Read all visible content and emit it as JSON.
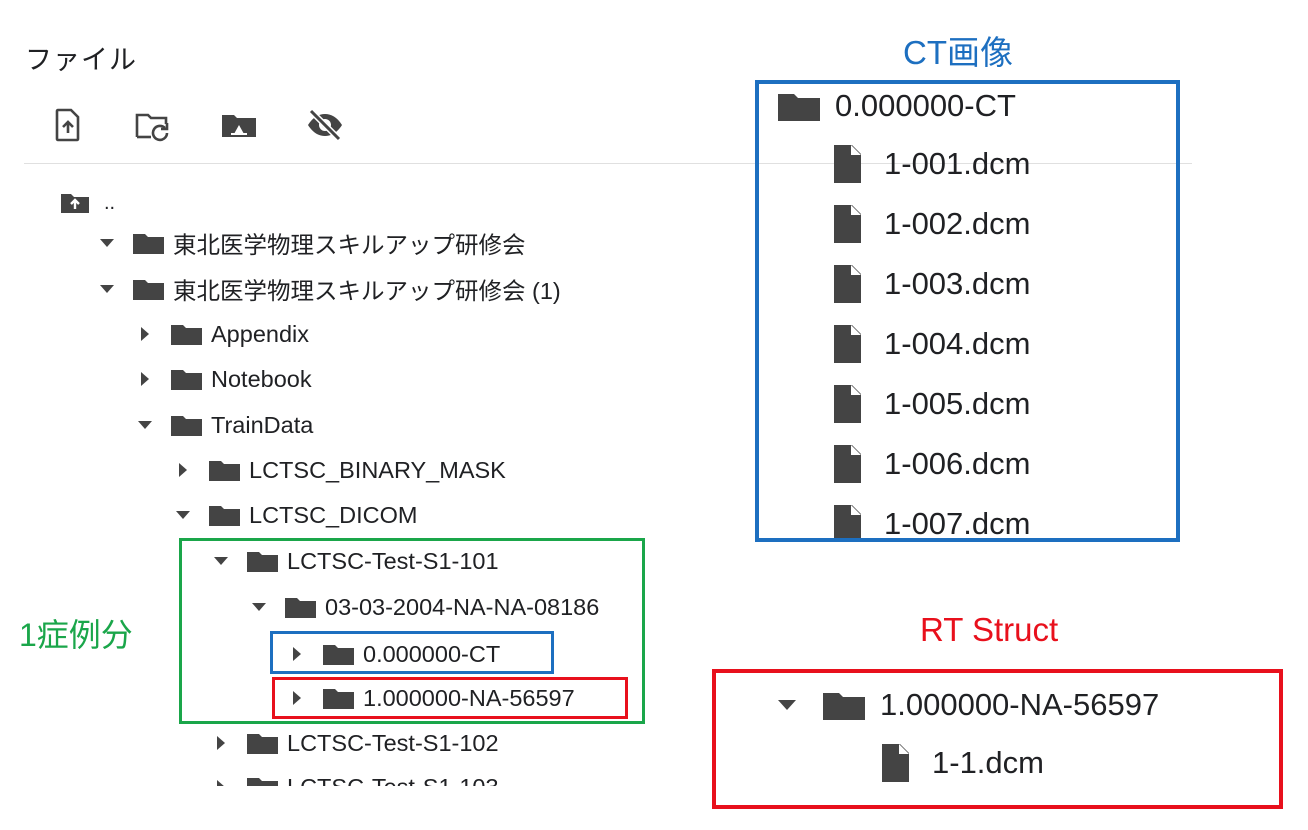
{
  "panel": {
    "title": "ファイル",
    "toolbar": [
      {
        "icon": "upload-file-icon"
      },
      {
        "icon": "refresh-folder-icon"
      },
      {
        "icon": "mount-drive-icon"
      },
      {
        "icon": "hide-hidden-files-icon"
      }
    ],
    "parent_label": ".."
  },
  "tree": [
    {
      "label": "東北医学物理スキルアップ研修会",
      "state": "expanded",
      "level": 0
    },
    {
      "label": "東北医学物理スキルアップ研修会 (1)",
      "state": "expanded",
      "level": 0
    },
    {
      "label": "Appendix",
      "state": "collapsed",
      "level": 1
    },
    {
      "label": "Notebook",
      "state": "collapsed",
      "level": 1
    },
    {
      "label": "TrainData",
      "state": "expanded",
      "level": 1
    },
    {
      "label": "LCTSC_BINARY_MASK",
      "state": "collapsed",
      "level": 2
    },
    {
      "label": "LCTSC_DICOM",
      "state": "expanded",
      "level": 2
    },
    {
      "label": "LCTSC-Test-S1-101",
      "state": "expanded",
      "level": 3
    },
    {
      "label": "03-03-2004-NA-NA-08186",
      "state": "expanded",
      "level": 4
    },
    {
      "label": "0.000000-CT",
      "state": "collapsed",
      "level": 5
    },
    {
      "label": "1.000000-NA-56597",
      "state": "collapsed",
      "level": 5
    },
    {
      "label": "LCTSC-Test-S1-102",
      "state": "collapsed",
      "level": 3
    },
    {
      "label": "LCTSC-Test-S1-103",
      "state": "collapsed",
      "level": 3
    }
  ],
  "annotations": {
    "case_label": "1症例分",
    "ct_label": "CT画像",
    "rt_label": "RT Struct",
    "colors": {
      "green": "#1aa64a",
      "blue": "#1d6fc0",
      "red": "#e8101c"
    }
  },
  "ct_panel": {
    "folder": "0.000000-CT",
    "files": [
      "1-001.dcm",
      "1-002.dcm",
      "1-003.dcm",
      "1-004.dcm",
      "1-005.dcm",
      "1-006.dcm",
      "1-007.dcm"
    ]
  },
  "rt_panel": {
    "folder": "1.000000-NA-56597",
    "files": [
      "1-1.dcm"
    ]
  }
}
